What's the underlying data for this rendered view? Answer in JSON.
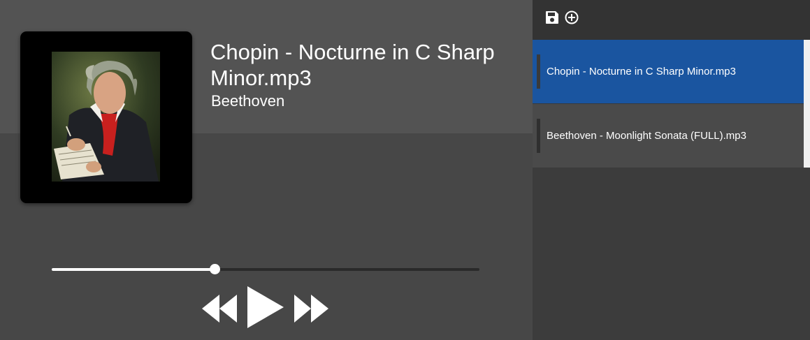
{
  "now_playing": {
    "title": "Chopin - Nocturne in C Sharp Minor.mp3",
    "artist": "Beethoven",
    "album_art": "beethoven-portrait",
    "progress_fraction": 0.38
  },
  "controls": {
    "rewind_icon": "rewind-icon",
    "play_icon": "play-icon",
    "fast_forward_icon": "fast-forward-icon"
  },
  "sidebar": {
    "toolbar": {
      "save_icon": "save-icon",
      "add_icon": "add-circle-icon"
    },
    "playlist": [
      {
        "label": "Chopin - Nocturne in C Sharp Minor.mp3",
        "active": true
      },
      {
        "label": "Beethoven - Moonlight Sonata (FULL).mp3",
        "active": false
      }
    ]
  },
  "colors": {
    "active_item": "#1a55a0",
    "player_bg": "#474747",
    "header_bg": "#535353",
    "sidebar_bg": "#3c3c3c",
    "toolbar_bg": "#333333"
  }
}
